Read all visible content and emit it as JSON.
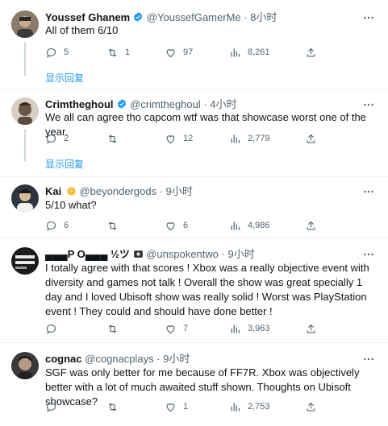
{
  "tweets": [
    {
      "name": "Youssef Ghanem",
      "handle": "@YoussefGamerMe",
      "time": "· 8小时",
      "text": "All of them 6/10",
      "replies": "5",
      "retweets": "1",
      "likes": "97",
      "views": "8,261",
      "show_replies": "显示回复"
    },
    {
      "name": "Crimtheghoul",
      "handle": "@crimtheghoul",
      "time": "· 4小时",
      "text": "We all can agree tho capcom wtf was that showcase worst one of the year.",
      "replies": "2",
      "retweets": "",
      "likes": "12",
      "views": "2,779",
      "show_replies": "显示回复"
    },
    {
      "name": "Kai",
      "handle": "@beyondergods",
      "time": "· 9小时",
      "text": "5/10 what?",
      "replies": "6",
      "retweets": "",
      "likes": "6",
      "views": "4,986"
    },
    {
      "name": "▄▄▄P O▄▄▄ ½ツ",
      "handle": "@unspokentwo",
      "time": "· 9小时",
      "text": "I totally agree with that scores ! Xbox was a really objective event with diversity and games not talk ! Overall the show was great specially 1 day and I loved Ubisoft show was really solid ! Worst was PlayStation event ! They could and should have done better !",
      "replies": "",
      "retweets": "",
      "likes": "7",
      "views": "3,963"
    },
    {
      "name": "cognac",
      "handle": "@cognacplays",
      "time": "· 9小时",
      "text": "SGF was only better for me because of FF7R. Xbox was objectively better with a lot of much awaited stuff shown. Thoughts on Ubisoft showcase?",
      "replies": "",
      "retweets": "",
      "likes": "1",
      "views": "2,753"
    }
  ],
  "colors": {
    "accent": "#1d9bf0",
    "muted": "#536471",
    "verified": "#1d9bf0",
    "divider": "#eff3f4"
  }
}
